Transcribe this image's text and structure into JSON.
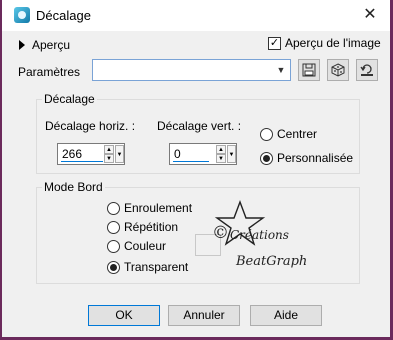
{
  "window": {
    "title": "Décalage",
    "close_glyph": "✕"
  },
  "preview": {
    "toggle_label": "Aperçu",
    "image_preview_label": "Aperçu de l'image",
    "image_preview_checked": true
  },
  "params": {
    "label": "Paramètres",
    "value": ""
  },
  "offset": {
    "group_label": "Décalage",
    "horiz_label": "Décalage horiz. :",
    "horiz_value": "266",
    "vert_label": "Décalage vert. :",
    "vert_value": "0",
    "center_label": "Centrer",
    "custom_label": "Personnalisée",
    "selected": "custom"
  },
  "edge": {
    "group_label": "Mode Bord",
    "options": [
      "Enroulement",
      "Répétition",
      "Couleur",
      "Transparent"
    ],
    "selected": "Transparent"
  },
  "watermark": {
    "line1": "Créations",
    "line2": "BeatGraph",
    "symbol": "©"
  },
  "buttons": {
    "ok": "OK",
    "cancel": "Annuler",
    "help": "Aide"
  },
  "colors": {
    "accent": "#0078d7",
    "frame": "#6b2a5c"
  }
}
